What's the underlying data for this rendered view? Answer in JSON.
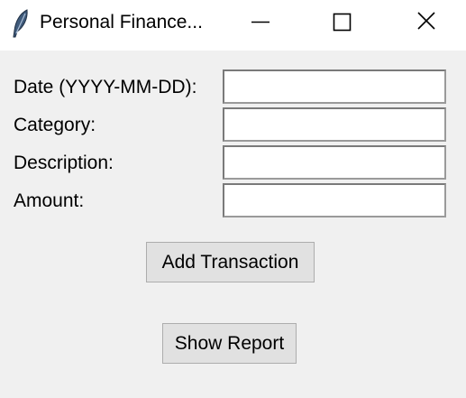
{
  "window": {
    "title": "Personal Finance...",
    "icon": "feather-icon",
    "controls": [
      "minimize-icon",
      "maximize-icon",
      "close-icon"
    ]
  },
  "form": {
    "fields": [
      {
        "label": "Date (YYYY-MM-DD):",
        "value": ""
      },
      {
        "label": "Category:",
        "value": ""
      },
      {
        "label": "Description:",
        "value": ""
      },
      {
        "label": "Amount:",
        "value": ""
      }
    ]
  },
  "buttons": {
    "add_transaction": "Add Transaction",
    "show_report": "Show Report"
  }
}
